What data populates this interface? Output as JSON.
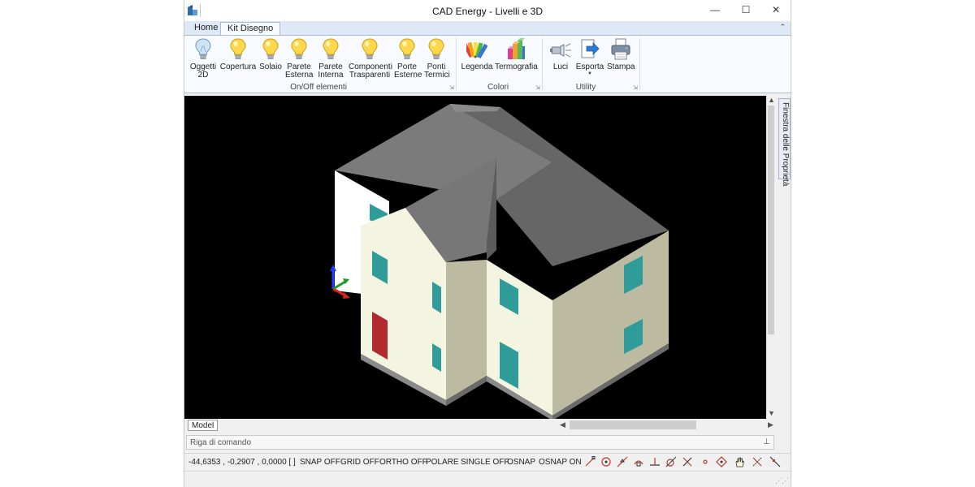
{
  "window": {
    "title": "CAD Energy - Livelli e 3D",
    "minimize": "—",
    "maximize": "☐",
    "close": "✕"
  },
  "ribbon": {
    "tabs": [
      "Home",
      "Kit Disegno"
    ],
    "collapse_glyph": "⌃",
    "groups": [
      {
        "label": "On/Off elementi",
        "buttons": [
          {
            "label": "Oggetti\n2D",
            "icon": "bulb-off-icon"
          },
          {
            "label": "Copertura",
            "icon": "bulb-on-icon"
          },
          {
            "label": "Solaio",
            "icon": "bulb-on-icon"
          },
          {
            "label": "Parete\nEsterna",
            "icon": "bulb-on-icon"
          },
          {
            "label": "Parete\nInterna",
            "icon": "bulb-on-icon"
          },
          {
            "label": "Componenti\nTrasparenti",
            "icon": "bulb-on-icon"
          },
          {
            "label": "Porte\nEsterne",
            "icon": "bulb-on-icon"
          },
          {
            "label": "Ponti\nTermici",
            "icon": "bulb-on-icon"
          }
        ]
      },
      {
        "label": "Colori",
        "buttons": [
          {
            "label": "Legenda",
            "icon": "color-swatches-icon"
          },
          {
            "label": "Termografia",
            "icon": "thermography-icon"
          }
        ]
      },
      {
        "label": "Utility",
        "buttons": [
          {
            "label": "Luci",
            "icon": "spotlight-icon"
          },
          {
            "label": "Esporta",
            "icon": "export-icon"
          },
          {
            "label": "Stampa",
            "icon": "printer-icon"
          }
        ]
      }
    ]
  },
  "side_panel": {
    "label": "Finestra delle Proprietà"
  },
  "workspace": {
    "model_tab": "Model"
  },
  "command_line": {
    "placeholder": "Riga di comando",
    "pin": "⊥"
  },
  "status": {
    "coords": "-44,6353 , -0,2907 , 0,0000 [ ]",
    "toggles": [
      "SNAP OFF",
      "GRID OFF",
      "ORTHO OFF",
      "POLARE",
      "SINGLE OFF",
      "OSNAP",
      "OSNAP ON"
    ],
    "snap_icons": [
      "endpoint-snap-icon",
      "center-snap-icon",
      "midpoint-snap-icon",
      "quadrant-snap-icon",
      "perpendicular-snap-icon",
      "tangent-snap-icon",
      "intersection-snap-icon",
      "node-snap-icon",
      "insertion-snap-icon",
      "pan-hand-icon",
      "extension-snap-icon",
      "nearest-snap-icon"
    ]
  },
  "colors": {
    "accent": "#aabbd2",
    "wall_cream": "#f4f5e1",
    "wall_shade": "#bcbba2",
    "wall_side": "#a9a991",
    "roof": "#7b7b7b",
    "window_glass": "#2f9c9a",
    "door": "#b02a2e",
    "viewport_bg": "#000000"
  }
}
